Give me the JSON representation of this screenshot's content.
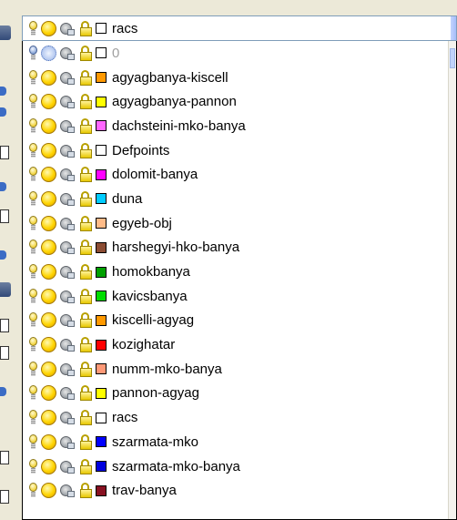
{
  "combo": {
    "selected_label": "racs",
    "selected_color": "#ffffff"
  },
  "layers": [
    {
      "name": "0",
      "color": "#ffffff",
      "on": false,
      "frozen": true,
      "dimmed": true
    },
    {
      "name": "agyagbanya-kiscell",
      "color": "#ff9900"
    },
    {
      "name": "agyagbanya-pannon",
      "color": "#ffff00"
    },
    {
      "name": "dachsteini-mko-banya",
      "color": "#ff66ff"
    },
    {
      "name": "Defpoints",
      "color": "#ffffff"
    },
    {
      "name": "dolomit-banya",
      "color": "#ff00ff"
    },
    {
      "name": "duna",
      "color": "#00ccff"
    },
    {
      "name": "egyeb-obj",
      "color": "#ffbb88"
    },
    {
      "name": "harshegyi-hko-banya",
      "color": "#8b4c33"
    },
    {
      "name": "homokbanya",
      "color": "#00a000"
    },
    {
      "name": "kavicsbanya",
      "color": "#00dd00"
    },
    {
      "name": "kiscelli-agyag",
      "color": "#ff9900"
    },
    {
      "name": "kozighatar",
      "color": "#ff0000"
    },
    {
      "name": "numm-mko-banya",
      "color": "#ff9977"
    },
    {
      "name": "pannon-agyag",
      "color": "#ffff00"
    },
    {
      "name": "racs",
      "color": "#ffffff"
    },
    {
      "name": "szarmata-mko",
      "color": "#0000ff"
    },
    {
      "name": "szarmata-mko-banya",
      "color": "#0000dd"
    },
    {
      "name": "trav-banya",
      "color": "#881122"
    }
  ],
  "icons": {
    "on_off": "lightbulb-icon",
    "freeze": "sun-icon",
    "freeze_off": "snowflake-icon",
    "viewport": "viewport-freeze-icon",
    "lock": "unlock-icon"
  }
}
